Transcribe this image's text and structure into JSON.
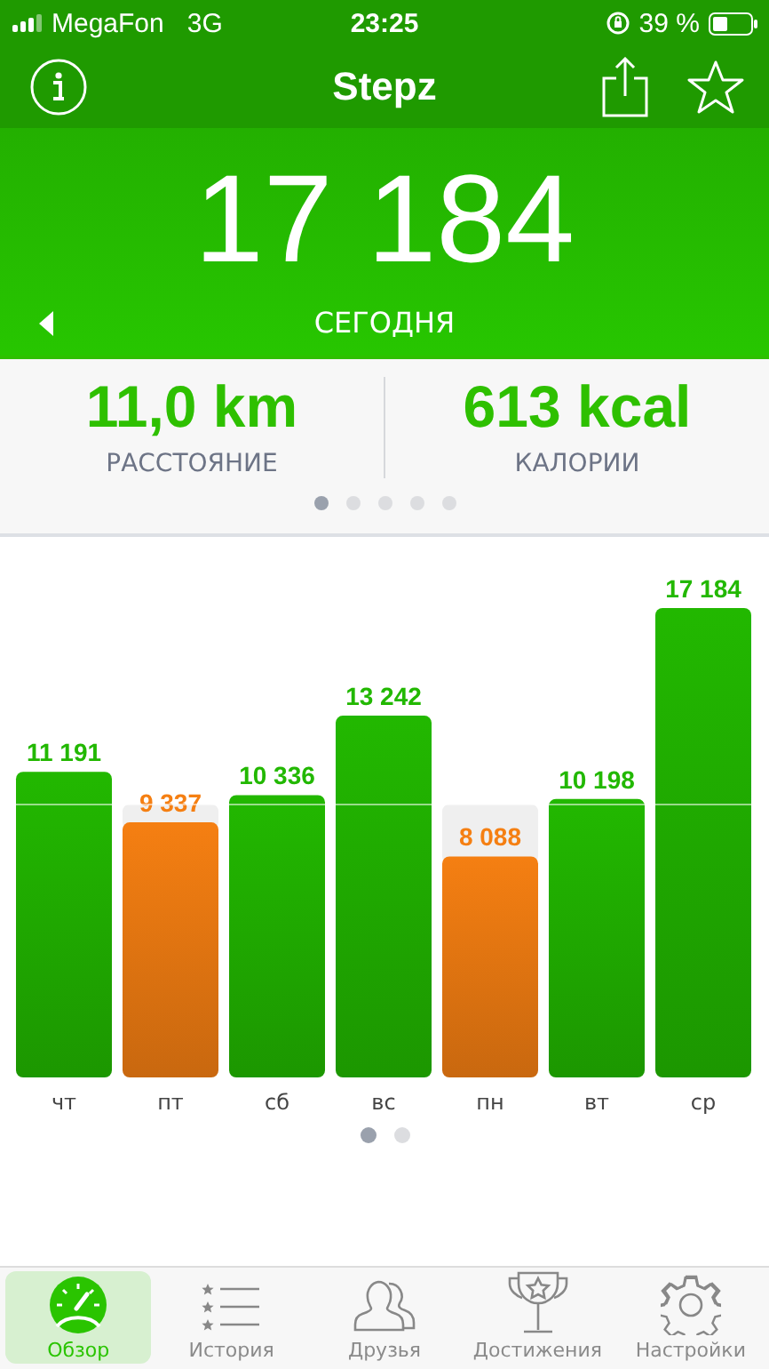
{
  "status_bar": {
    "carrier": "MegaFon",
    "network": "3G",
    "time": "23:25",
    "battery_percent": "39 %"
  },
  "nav_bar": {
    "title": "Stepz"
  },
  "today": {
    "steps": "17 184",
    "label": "СЕГОДНЯ"
  },
  "stats": [
    {
      "value": "11,0 km",
      "label": "РАССТОЯНИЕ"
    },
    {
      "value": "613 kcal",
      "label": "КАЛОРИИ"
    }
  ],
  "stats_pages": [
    {
      "selected": true
    },
    {
      "selected": false
    },
    {
      "selected": false
    },
    {
      "selected": false
    },
    {
      "selected": false
    }
  ],
  "week": {
    "chart_data": {
      "type": "bar",
      "categories": [
        "чт",
        "пт",
        "сб",
        "вс",
        "пн",
        "вт",
        "ср"
      ],
      "stacked": true,
      "data_labels": true,
      "series": [
        {
          "color": "#22b800",
          "values": [
            11191,
            null,
            10336,
            13242,
            null,
            10198,
            17184
          ]
        },
        {
          "color": "#f57f12",
          "values": [
            null,
            9337,
            null,
            null,
            8088,
            null,
            null
          ]
        }
      ]
    }
  },
  "week_pages": [
    {
      "selected": true
    },
    {
      "selected": false
    }
  ],
  "tabs": [
    {
      "label": "Обзор",
      "kind": "gauge",
      "selected": true
    },
    {
      "label": "История",
      "kind": "list",
      "selected": false
    },
    {
      "label": "Друзья",
      "kind": "people",
      "selected": false
    },
    {
      "label": "Достижения",
      "kind": "trophy",
      "selected": false
    },
    {
      "label": "Настройки",
      "kind": "gear",
      "selected": false
    }
  ]
}
